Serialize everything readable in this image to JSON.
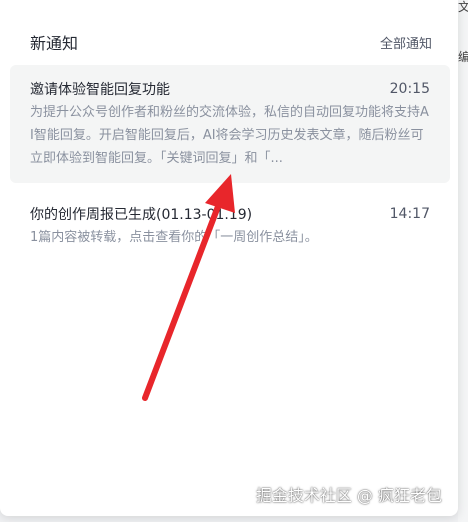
{
  "header": {
    "title": "新通知",
    "all_link": "全部通知"
  },
  "notifications": [
    {
      "title": "邀请体验智能回复功能",
      "time": "20:15",
      "body": "为提升公众号创作者和粉丝的交流体验，私信的自动回复功能将支持AI智能回复。开启智能回复后，AI将会学习历史发表文章，随后粉丝可立即体验到智能回复。「关键词回复」和「..."
    },
    {
      "title": "你的创作周报已生成(01.13-01.19)",
      "time": "14:17",
      "body": "1篇内容被转载，点击查看你的「一周创作总结」。"
    }
  ],
  "side_text": {
    "line1": "文",
    "line2": "编"
  },
  "watermark": "掘金技术社区 @ 疯狂老包",
  "annotation": {
    "color": "#e8262b"
  }
}
